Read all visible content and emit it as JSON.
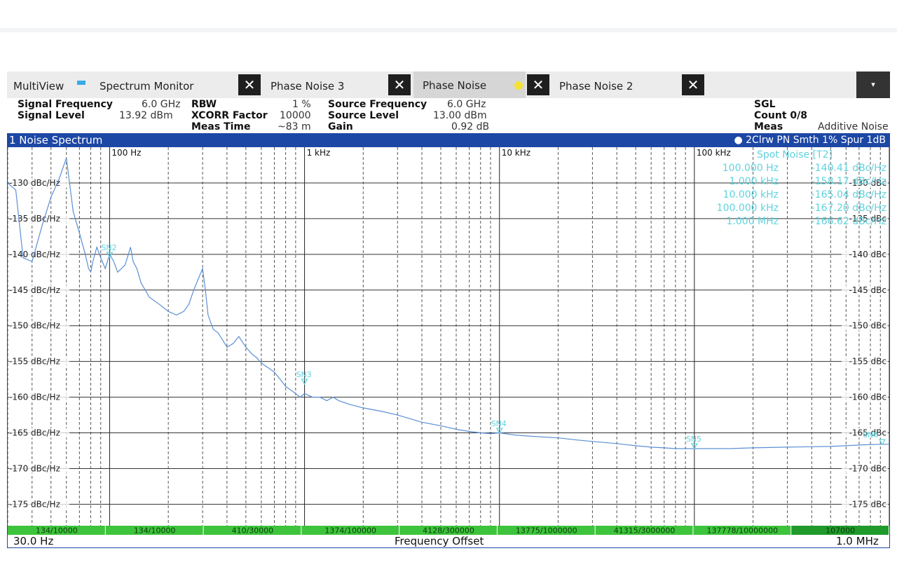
{
  "tabs": {
    "multiview": "MultiView",
    "spectrum_monitor": "Spectrum Monitor",
    "phase_noise_3": "Phase Noise 3",
    "phase_noise": "Phase Noise",
    "phase_noise_2": "Phase Noise 2",
    "close_symbol": "✕",
    "menu_symbol": "▾"
  },
  "info": {
    "signal_frequency_label": "Signal Frequency",
    "signal_frequency_value": "6.0 GHz",
    "signal_level_label": "Signal Level",
    "signal_level_value": "13.92 dBm",
    "rbw_label": "RBW",
    "rbw_value": "1 %",
    "xcorr_label": "XCORR Factor",
    "xcorr_value": "10000",
    "meas_time_label": "Meas Time",
    "meas_time_value": "~83 m",
    "source_frequency_label": "Source Frequency",
    "source_frequency_value": "6.0 GHz",
    "source_level_label": "Source Level",
    "source_level_value": "13.00 dBm",
    "gain_label": "Gain",
    "gain_value": "0.92 dB",
    "sgl": "SGL",
    "count": "Count 0/8",
    "meas_label": "Meas",
    "meas_value": "Additive Noise"
  },
  "window": {
    "title": "1 Noise Spectrum",
    "trace_info": "● 2Clrw PN Smth 1% Spur 1dB"
  },
  "chart_data": {
    "type": "line",
    "x_scale": "log",
    "xlim": [
      30,
      1000000
    ],
    "ylim": [
      -178,
      -125
    ],
    "grid": true,
    "x_decade_labels": [
      {
        "x": 100,
        "label": "100 Hz"
      },
      {
        "x": 1000,
        "label": "1 kHz"
      },
      {
        "x": 10000,
        "label": "10 kHz"
      },
      {
        "x": 100000,
        "label": "100 kHz"
      }
    ],
    "y_ticks": [
      -130,
      -135,
      -140,
      -145,
      -150,
      -155,
      -160,
      -165,
      -170,
      -175
    ],
    "y_tick_labels_left": [
      "-130 dBc/Hz",
      "-135 dBc/Hz",
      "-140 dBc/Hz",
      "-145 dBc/Hz",
      "-150 dBc/Hz",
      "-155 dBc/Hz",
      "-160 dBc/Hz",
      "-165 dBc/Hz",
      "-170 dBc/Hz",
      "-175 dBc/Hz"
    ],
    "y_tick_labels_right": [
      "-130 dBc",
      "-135 dBc",
      "-140 dBc",
      "-145 dBc",
      "-150 dBc",
      "-155 dBc",
      "-160 dBc",
      "-165 dBc",
      "-170 dBc",
      "-175 dBc"
    ],
    "series": [
      {
        "color": "#5b8fd4",
        "x": [
          30,
          33,
          36,
          40,
          45,
          50,
          55,
          60,
          65,
          70,
          75,
          78,
          80,
          82,
          86,
          90,
          95,
          100,
          105,
          110,
          120,
          128,
          132,
          138,
          145,
          160,
          180,
          200,
          220,
          240,
          255,
          270,
          300,
          310,
          320,
          340,
          360,
          380,
          400,
          430,
          460,
          500,
          540,
          570,
          590,
          620,
          660,
          700,
          750,
          800,
          850,
          900,
          950,
          1000,
          1100,
          1200,
          1300,
          1400,
          1500,
          1700,
          2000,
          2500,
          3000,
          4000,
          5000,
          6000,
          7000,
          8000,
          9000,
          10000,
          12000,
          15000,
          20000,
          25000,
          30000,
          40000,
          50000,
          60000,
          70000,
          80000,
          100000,
          150000,
          200000,
          300000,
          500000,
          700000,
          900000,
          1000000
        ],
        "y": [
          -130.0,
          -131.0,
          -140.5,
          -141.0,
          -136.0,
          -132.0,
          -129.5,
          -126.5,
          -134.0,
          -137.0,
          -140.0,
          -142.0,
          -142.5,
          -141.0,
          -139.0,
          -140.5,
          -142.0,
          -140.0,
          -141.0,
          -142.5,
          -141.5,
          -139.0,
          -141.0,
          -142.0,
          -144.0,
          -146.0,
          -147.0,
          -148.0,
          -148.5,
          -148.0,
          -147.0,
          -145.0,
          -142.0,
          -145.0,
          -148.5,
          -150.5,
          -151.0,
          -152.0,
          -153.0,
          -152.5,
          -151.5,
          -153.0,
          -154.0,
          -154.5,
          -155.0,
          -155.5,
          -156.0,
          -156.5,
          -157.5,
          -158.5,
          -159.0,
          -159.5,
          -160.0,
          -159.5,
          -160.0,
          -160.0,
          -160.5,
          -160.0,
          -160.5,
          -161.0,
          -161.5,
          -162.0,
          -162.5,
          -163.5,
          -164.0,
          -164.5,
          -164.8,
          -165.0,
          -165.1,
          -165.0,
          -165.3,
          -165.5,
          -165.7,
          -166.0,
          -166.2,
          -166.5,
          -166.8,
          -167.0,
          -167.1,
          -167.2,
          -167.2,
          -167.2,
          -167.1,
          -167.0,
          -166.9,
          -166.7,
          -166.6,
          -166.6
        ]
      }
    ],
    "markers": [
      {
        "label": "SN2",
        "x": 100,
        "y": -140.41
      },
      {
        "label": "SN3",
        "x": 1000,
        "y": -158.17
      },
      {
        "label": "SN4",
        "x": 10000,
        "y": -165.04
      },
      {
        "label": "SN5",
        "x": 100000,
        "y": -167.2
      },
      {
        "label": "SN6",
        "x": 1000000,
        "y": -166.62
      }
    ]
  },
  "spot_noise": {
    "title": "Spot Noise [T2]",
    "rows": [
      {
        "freq": "100.000 Hz",
        "value": "-140.41 dBc/Hz"
      },
      {
        "freq": "1.000 kHz",
        "value": "-158.17 dBc/Hz"
      },
      {
        "freq": "10.000 kHz",
        "value": "-165.04 dBc/Hz"
      },
      {
        "freq": "100.000 kHz",
        "value": "-167.20 dBc/Hz"
      },
      {
        "freq": "1.000 MHz",
        "value": "-166.62 dBc/Hz"
      }
    ]
  },
  "xcorr_bar": {
    "segments": [
      "134/10000",
      "134/10000",
      "410/30000",
      "1374/100000",
      "4128/300000",
      "13775/1000000",
      "41315/3000000",
      "137778/10000000",
      "107000"
    ]
  },
  "footer": {
    "start": "30.0 Hz",
    "center": "Frequency Offset",
    "stop": "1.0 MHz"
  }
}
